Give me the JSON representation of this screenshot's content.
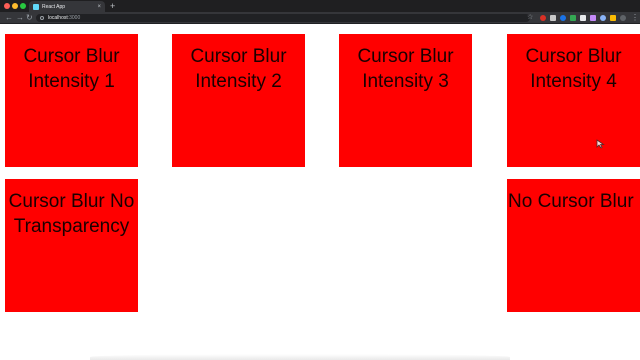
{
  "browser": {
    "tab_title": "React App",
    "tab_close": "×",
    "new_tab": "+",
    "nav_back": "←",
    "nav_forward": "→",
    "nav_reload": "↻",
    "url_host": "localhost",
    "url_port": ":3000",
    "bookmark_star": "☆",
    "menu": "⋮"
  },
  "boxes": [
    {
      "label": "Cursor Blur Intensity 1"
    },
    {
      "label": "Cursor Blur Intensity 2"
    },
    {
      "label": "Cursor Blur Intensity 3"
    },
    {
      "label": "Cursor Blur Intensity 4"
    },
    {
      "label": "Cursor Blur No Transparency"
    },
    {
      "label": "No Cursor Blur"
    }
  ],
  "colors": {
    "box_background": "#ff0000",
    "page_background": "#ffffff"
  }
}
